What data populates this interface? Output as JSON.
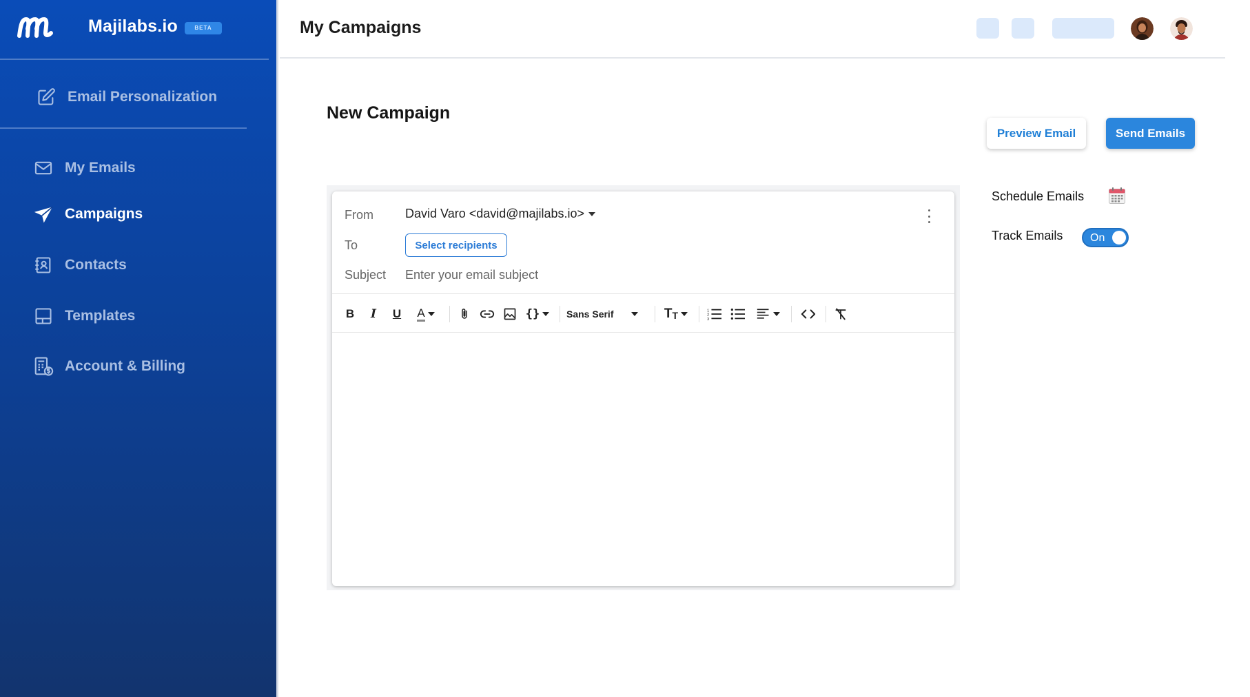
{
  "sidebar": {
    "brand_name": "Majilabs.io",
    "beta_label": "BETA",
    "personalization_label": "Email Personalization",
    "items": [
      {
        "label": "My Emails",
        "icon": "mail-icon"
      },
      {
        "label": "Campaigns",
        "icon": "paper-plane-icon",
        "active": true
      },
      {
        "label": "Contacts",
        "icon": "contacts-book-icon"
      },
      {
        "label": "Templates",
        "icon": "template-icon"
      },
      {
        "label": "Account & Billing",
        "icon": "billing-icon"
      }
    ]
  },
  "header": {
    "title": "My Campaigns"
  },
  "main": {
    "section_title": "New Campaign",
    "preview_label": "Preview Email",
    "send_label": "Send Emails",
    "schedule_label": "Schedule Emails",
    "track_label": "Track Emails",
    "track_toggle_label": "On"
  },
  "compose": {
    "from_label": "From",
    "from_value": "David Varo <david@majilabs.io>",
    "to_label": "To",
    "recipients_button": "Select recipients",
    "subject_label": "Subject",
    "subject_placeholder": "Enter your email subject",
    "toolbar": {
      "font_family": "Sans Serif"
    }
  },
  "colors": {
    "sidebar_top": "#0a4cb8",
    "sidebar_bottom": "#12346e",
    "accent": "#2b86dd",
    "header_placeholder": "#dbe9fb"
  }
}
